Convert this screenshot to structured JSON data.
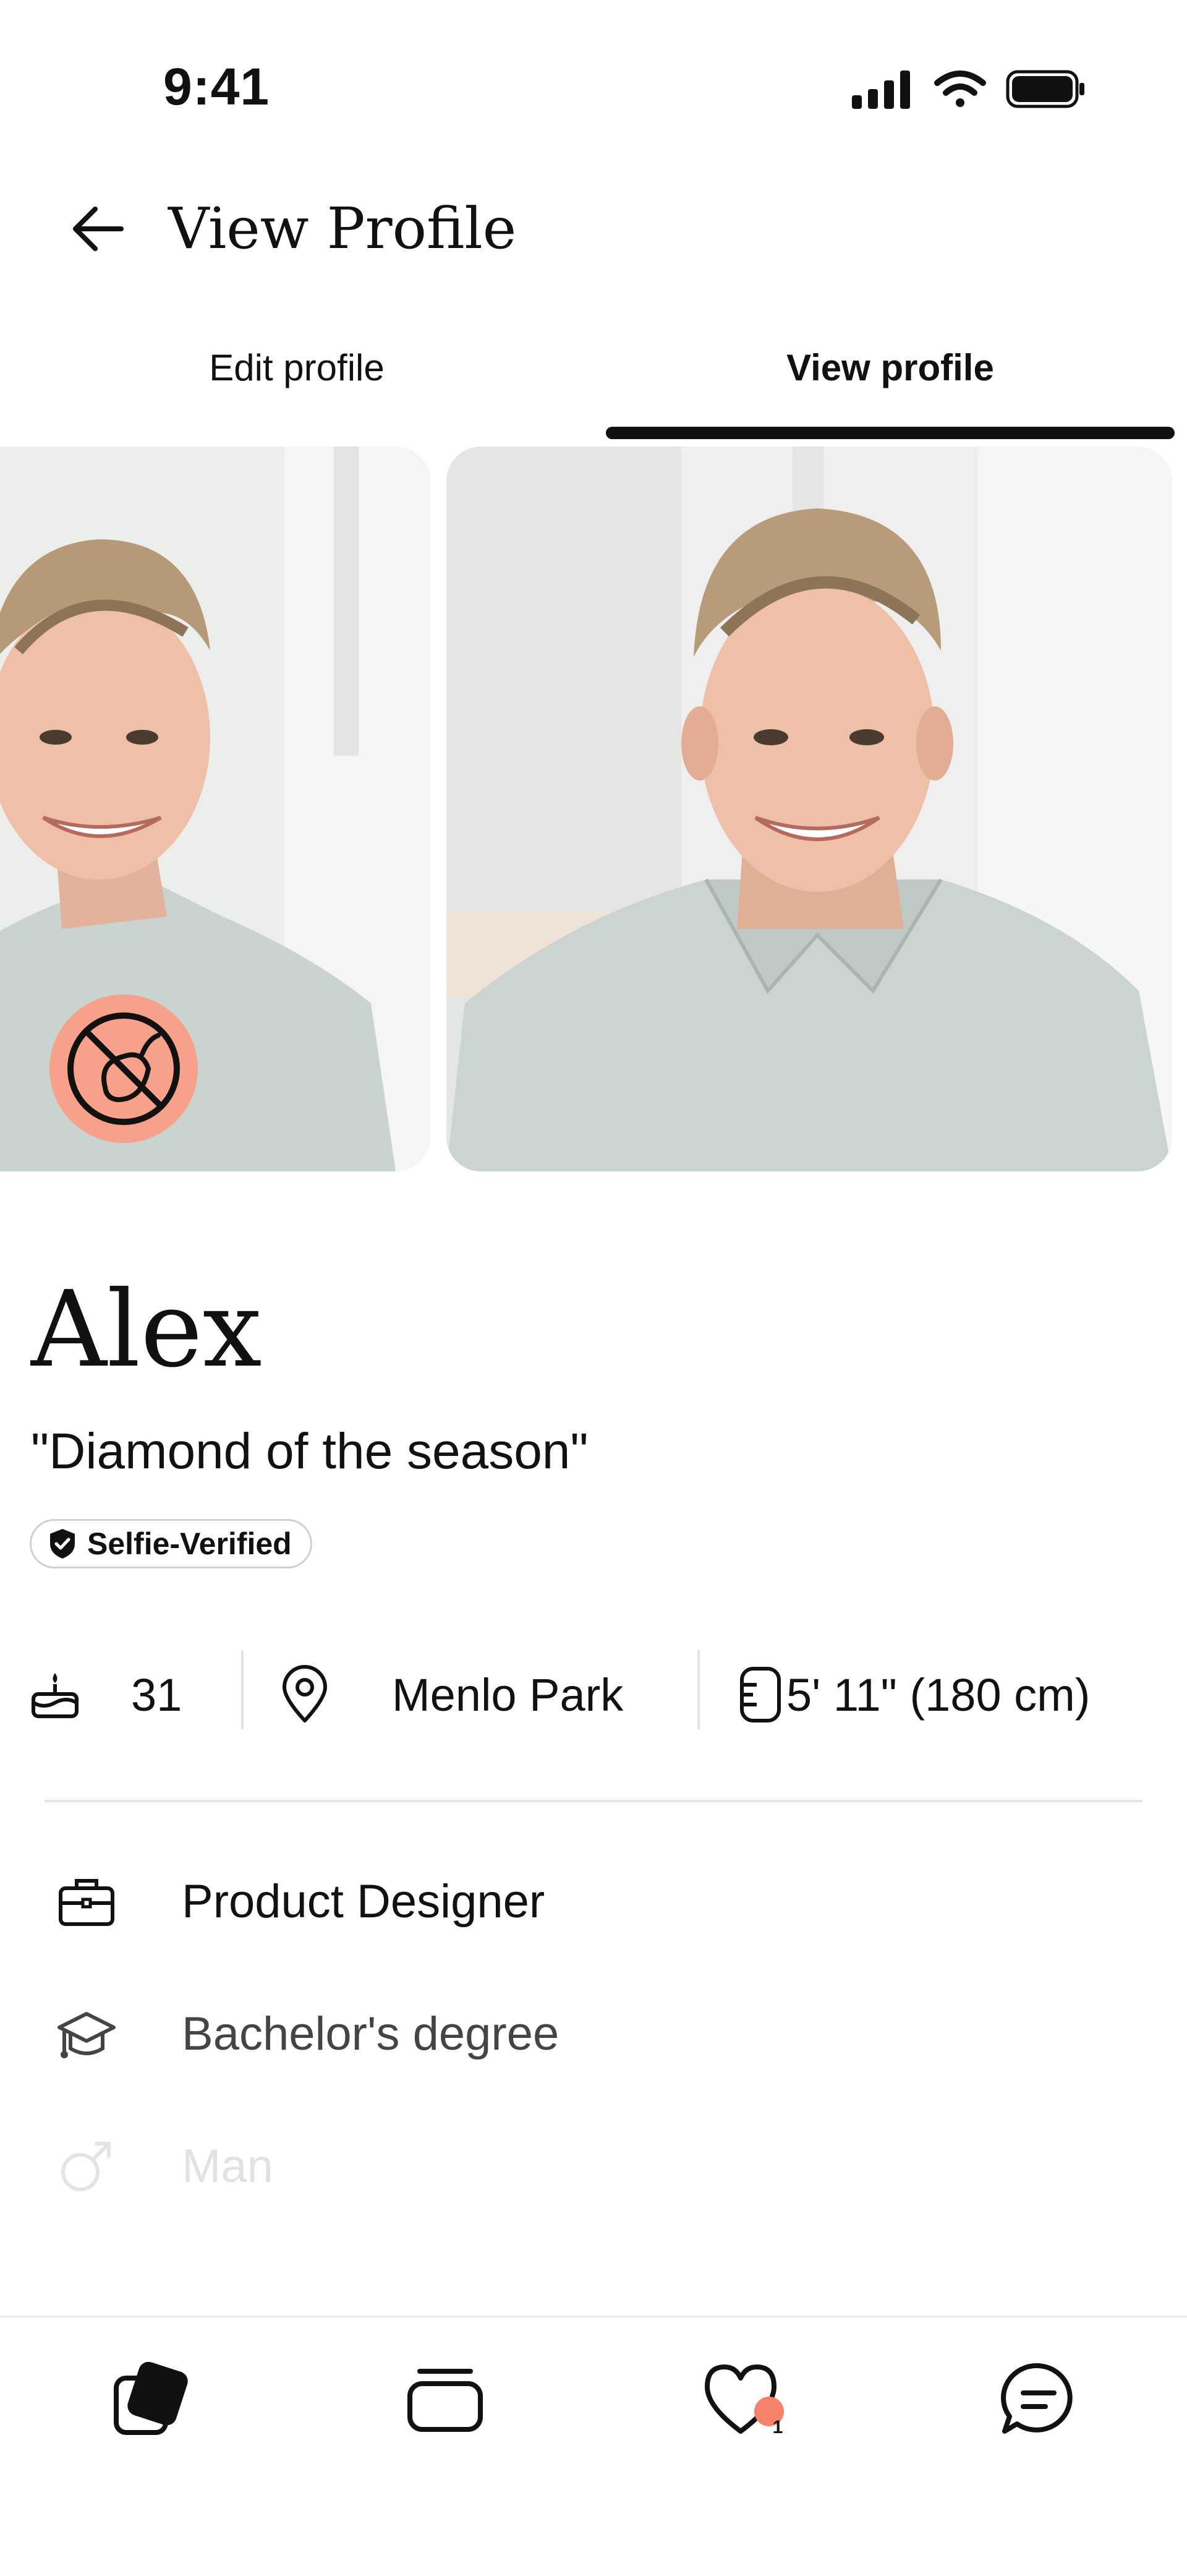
{
  "status_bar": {
    "time": "9:41",
    "icons": [
      "signal-icon",
      "wifi-icon",
      "battery-icon"
    ]
  },
  "header": {
    "title": "View Profile",
    "back_icon": "arrow-left-icon"
  },
  "tabs": [
    {
      "label": "Edit profile",
      "active": false
    },
    {
      "label": "View profile",
      "active": true
    }
  ],
  "photos": [
    {
      "name": "profile-photo-1",
      "badge_icon": "no-eggplant-icon"
    },
    {
      "name": "profile-photo-2"
    }
  ],
  "profile": {
    "name": "Alex",
    "tagline": "\"Diamond of the season\"",
    "verified_label": "Selfie-Verified"
  },
  "stats": {
    "age": "31",
    "location": "Menlo Park",
    "height": "5' 11\" (180 cm)"
  },
  "details": [
    {
      "icon": "briefcase-icon",
      "label": "Product Designer"
    },
    {
      "icon": "graduation-cap-icon",
      "label": "Bachelor's degree"
    },
    {
      "icon": "male-symbol-icon",
      "label": "Man"
    }
  ],
  "bottom_nav": {
    "items": [
      "cards-icon",
      "stack-icon",
      "likes-icon",
      "chat-icon"
    ],
    "likes_badge": "1"
  },
  "colors": {
    "accent": "#f7a08a",
    "badge": "#f5816a",
    "text": "#111111"
  }
}
